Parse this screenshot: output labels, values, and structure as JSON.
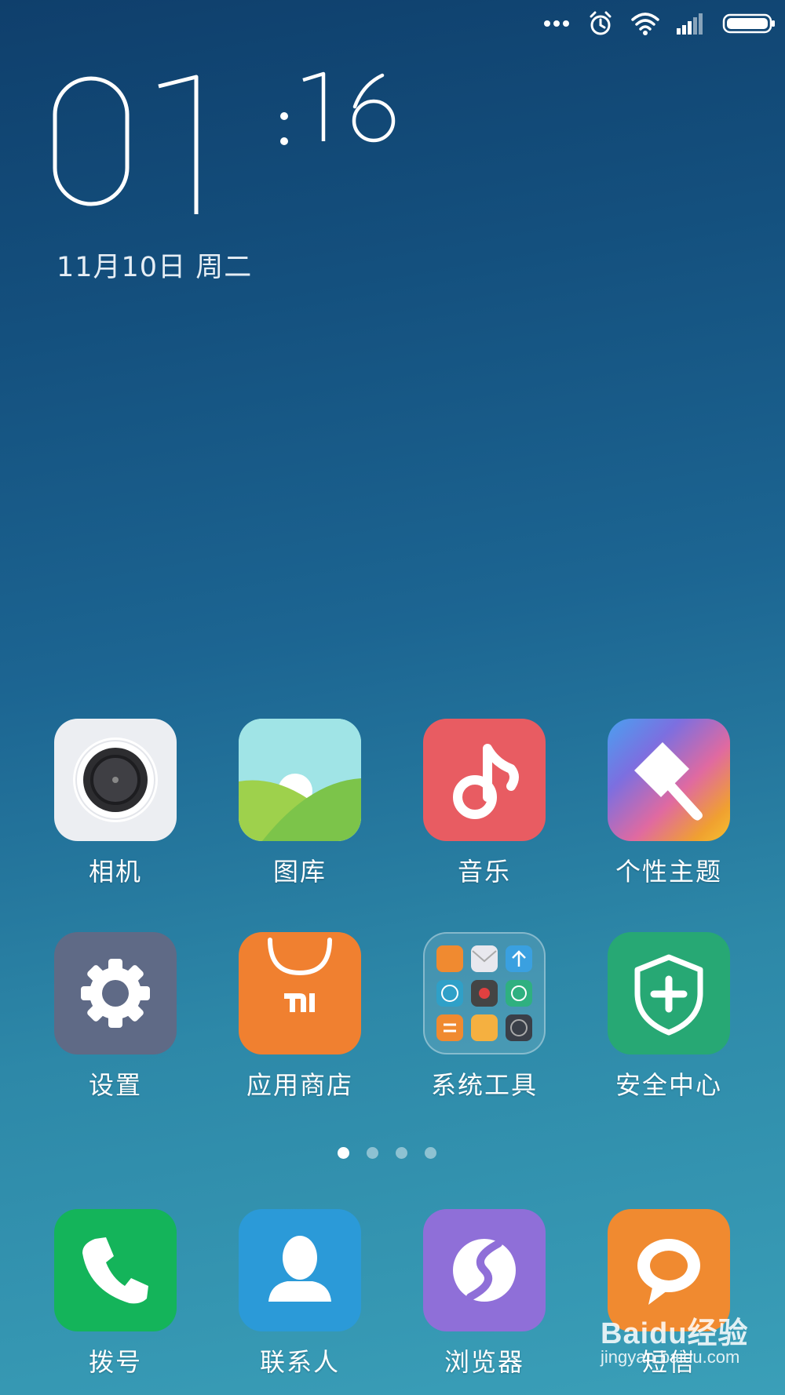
{
  "clock": {
    "hour": "01",
    "minute": "16"
  },
  "date": "11月10日 周二",
  "home_rows": [
    [
      {
        "name": "camera-app",
        "label": "相机",
        "icon": "camera-icon"
      },
      {
        "name": "gallery-app",
        "label": "图库",
        "icon": "gallery-icon"
      },
      {
        "name": "music-app",
        "label": "音乐",
        "icon": "music-note-icon"
      },
      {
        "name": "themes-app",
        "label": "个性主题",
        "icon": "paintbrush-icon"
      }
    ],
    [
      {
        "name": "settings-app",
        "label": "设置",
        "icon": "gear-icon"
      },
      {
        "name": "app-store-app",
        "label": "应用商店",
        "icon": "mi-shopping-bag-icon"
      },
      {
        "name": "system-tools-folder",
        "label": "系统工具",
        "icon": "folder-icon"
      },
      {
        "name": "security-center-app",
        "label": "安全中心",
        "icon": "shield-plus-icon"
      }
    ]
  ],
  "dock": [
    {
      "name": "dialer-app",
      "label": "拨号",
      "icon": "phone-icon"
    },
    {
      "name": "contacts-app",
      "label": "联系人",
      "icon": "person-icon"
    },
    {
      "name": "browser-app",
      "label": "浏览器",
      "icon": "browser-icon"
    },
    {
      "name": "messages-app",
      "label": "短信",
      "icon": "chat-bubble-icon"
    }
  ],
  "pager": {
    "pages": 4,
    "current": 1
  },
  "watermark": {
    "line1": "Baidu经验",
    "line2": "jingyan.baidu.com"
  },
  "colors": {
    "camera": "#eceef2",
    "music": "#e85c62",
    "settings": "#5f6a86",
    "store": "#f08030",
    "security": "#27a874",
    "dialer": "#14b45a",
    "contacts": "#2b9ad8",
    "browser": "#8f6fd8",
    "messages": "#f08a30"
  }
}
